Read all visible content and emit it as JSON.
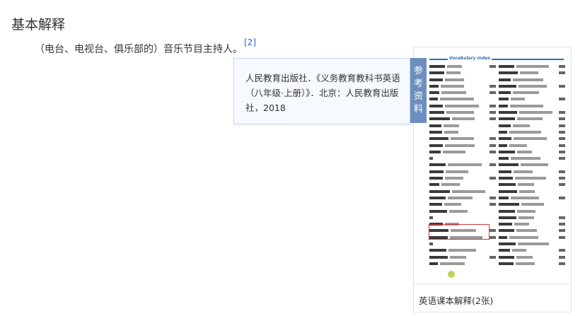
{
  "section": {
    "title": "基本解释"
  },
  "definition": {
    "text": "（电台、电视台、俱乐部的）音乐节目主持人。"
  },
  "reference": {
    "marker": "[2]",
    "popup_text": "人民教育出版社．《义务教育教科书英语（八年级·上册）》．北京：人民教育出版社，2018",
    "tab_label": "参考资料"
  },
  "image_card": {
    "scan_title": "Vocabulary index",
    "caption": "英语课本解释(2张)"
  }
}
